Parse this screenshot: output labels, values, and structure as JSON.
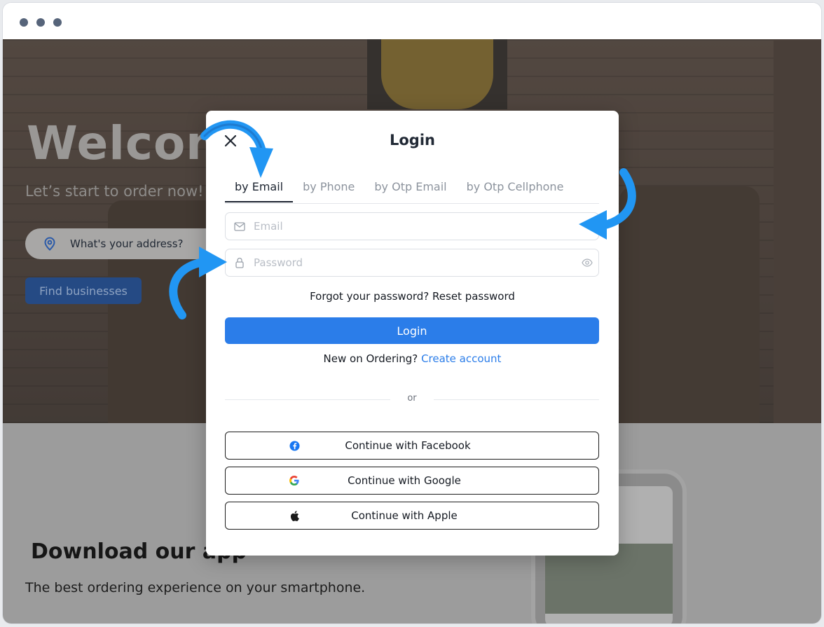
{
  "page": {
    "welcome": "Welcom",
    "subtitle": "Let’s start to order now!",
    "address_placeholder": "What's your address?",
    "find_button": "Find businesses",
    "download_title": "Download our app",
    "download_subtitle": "The best ordering experience on your smartphone."
  },
  "modal": {
    "title": "Login",
    "tabs": [
      {
        "label": "by Email",
        "active": true
      },
      {
        "label": "by Phone",
        "active": false
      },
      {
        "label": "by Otp Email",
        "active": false
      },
      {
        "label": "by Otp Cellphone",
        "active": false
      }
    ],
    "email_placeholder": "Email",
    "password_placeholder": "Password",
    "forgot_text": "Forgot your password? Reset password",
    "login_button": "Login",
    "new_on_text": "New on Ordering?",
    "create_account": "Create account",
    "or_text": "or",
    "social": {
      "facebook": "Continue with Facebook",
      "google": "Continue with Google",
      "apple": "Continue with Apple"
    }
  },
  "colors": {
    "accent": "#2b7de9",
    "annotation_arrow": "#2196f3"
  },
  "icons": [
    "close-icon",
    "email-icon",
    "lock-icon",
    "eye-icon",
    "facebook-icon",
    "google-icon",
    "apple-icon",
    "location-pin-icon"
  ]
}
